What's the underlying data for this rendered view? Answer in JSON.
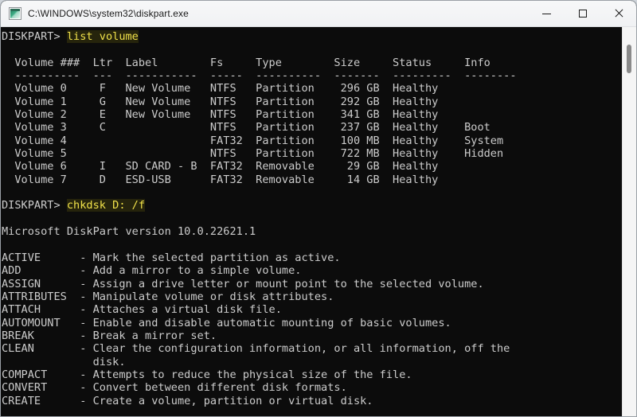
{
  "window": {
    "title": "C:\\WINDOWS\\system32\\diskpart.exe",
    "icon": "console-app-icon",
    "controls": {
      "minimize_label": "Minimize",
      "maximize_label": "Maximize",
      "close_label": "Close"
    }
  },
  "colors": {
    "console_background": "#0c0c0c",
    "console_foreground": "#cccccc",
    "command_highlight_text": "#f0e14a",
    "command_highlight_background": "#26240c",
    "titlebar_background": "#f3f4f6",
    "scrollbar_thumb": "#8a8a8a"
  },
  "console": {
    "prompt": "DISKPART>",
    "commands": [
      {
        "prompt": "DISKPART>",
        "text": "list volume"
      },
      {
        "prompt": "DISKPART>",
        "text": "chkdsk D: /f"
      }
    ],
    "volume_table": {
      "headers": [
        "Volume ###",
        "Ltr",
        "Label",
        "Fs",
        "Type",
        "Size",
        "Status",
        "Info"
      ],
      "separators": [
        "----------",
        "---",
        "-----------",
        "-----",
        "----------",
        "-------",
        "---------",
        "--------"
      ],
      "rows": [
        {
          "volume": "Volume 0",
          "ltr": "F",
          "label": "New Volume",
          "fs": "NTFS",
          "type": "Partition",
          "size": "296 GB",
          "status": "Healthy",
          "info": ""
        },
        {
          "volume": "Volume 1",
          "ltr": "G",
          "label": "New Volume",
          "fs": "NTFS",
          "type": "Partition",
          "size": "292 GB",
          "status": "Healthy",
          "info": ""
        },
        {
          "volume": "Volume 2",
          "ltr": "E",
          "label": "New Volume",
          "fs": "NTFS",
          "type": "Partition",
          "size": "341 GB",
          "status": "Healthy",
          "info": ""
        },
        {
          "volume": "Volume 3",
          "ltr": "C",
          "label": "",
          "fs": "NTFS",
          "type": "Partition",
          "size": "237 GB",
          "status": "Healthy",
          "info": "Boot"
        },
        {
          "volume": "Volume 4",
          "ltr": "",
          "label": "",
          "fs": "FAT32",
          "type": "Partition",
          "size": "100 MB",
          "status": "Healthy",
          "info": "System"
        },
        {
          "volume": "Volume 5",
          "ltr": "",
          "label": "",
          "fs": "NTFS",
          "type": "Partition",
          "size": "722 MB",
          "status": "Healthy",
          "info": "Hidden"
        },
        {
          "volume": "Volume 6",
          "ltr": "I",
          "label": "SD CARD - B",
          "fs": "FAT32",
          "type": "Removable",
          "size": "29 GB",
          "status": "Healthy",
          "info": ""
        },
        {
          "volume": "Volume 7",
          "ltr": "D",
          "label": "ESD-USB",
          "fs": "FAT32",
          "type": "Removable",
          "size": "14 GB",
          "status": "Healthy",
          "info": ""
        }
      ]
    },
    "version_line": "Microsoft DiskPart version 10.0.22621.1",
    "help_commands": [
      {
        "name": "ACTIVE",
        "description": "Mark the selected partition as active."
      },
      {
        "name": "ADD",
        "description": "Add a mirror to a simple volume."
      },
      {
        "name": "ASSIGN",
        "description": "Assign a drive letter or mount point to the selected volume."
      },
      {
        "name": "ATTRIBUTES",
        "description": "Manipulate volume or disk attributes."
      },
      {
        "name": "ATTACH",
        "description": "Attaches a virtual disk file."
      },
      {
        "name": "AUTOMOUNT",
        "description": "Enable and disable automatic mounting of basic volumes."
      },
      {
        "name": "BREAK",
        "description": "Break a mirror set."
      },
      {
        "name": "CLEAN",
        "description": "Clear the configuration information, or all information, off the"
      },
      {
        "name": "",
        "description": "disk.",
        "continuation": true
      },
      {
        "name": "COMPACT",
        "description": "Attempts to reduce the physical size of the file."
      },
      {
        "name": "CONVERT",
        "description": "Convert between different disk formats."
      },
      {
        "name": "CREATE",
        "description": "Create a volume, partition or virtual disk."
      }
    ],
    "full_text_lines": [
      "DISKPART> list volume",
      "",
      "  Volume ###  Ltr  Label        Fs     Type        Size     Status     Info",
      "  ----------  ---  -----------  -----  ----------  -------  ---------  --------",
      "  Volume 0     F   New Volume   NTFS   Partition    296 GB  Healthy",
      "  Volume 1     G   New Volume   NTFS   Partition    292 GB  Healthy",
      "  Volume 2     E   New Volume   NTFS   Partition    341 GB  Healthy",
      "  Volume 3     C                NTFS   Partition    237 GB  Healthy    Boot",
      "  Volume 4                      FAT32  Partition    100 MB  Healthy    System",
      "  Volume 5                      NTFS   Partition    722 MB  Healthy    Hidden",
      "  Volume 6     I   SD CARD - B  FAT32  Removable     29 GB  Healthy",
      "  Volume 7     D   ESD-USB      FAT32  Removable     14 GB  Healthy",
      "",
      "DISKPART> chkdsk D: /f",
      "",
      "Microsoft DiskPart version 10.0.22621.1",
      "",
      "ACTIVE      - Mark the selected partition as active.",
      "ADD         - Add a mirror to a simple volume.",
      "ASSIGN      - Assign a drive letter or mount point to the selected volume.",
      "ATTRIBUTES  - Manipulate volume or disk attributes.",
      "ATTACH      - Attaches a virtual disk file.",
      "AUTOMOUNT   - Enable and disable automatic mounting of basic volumes.",
      "BREAK       - Break a mirror set.",
      "CLEAN       - Clear the configuration information, or all information, off the",
      "              disk.",
      "COMPACT     - Attempts to reduce the physical size of the file.",
      "CONVERT     - Convert between different disk formats.",
      "CREATE      - Create a volume, partition or virtual disk."
    ]
  },
  "scrollbar": {
    "orientation": "vertical",
    "thumb_position": "near-top"
  }
}
